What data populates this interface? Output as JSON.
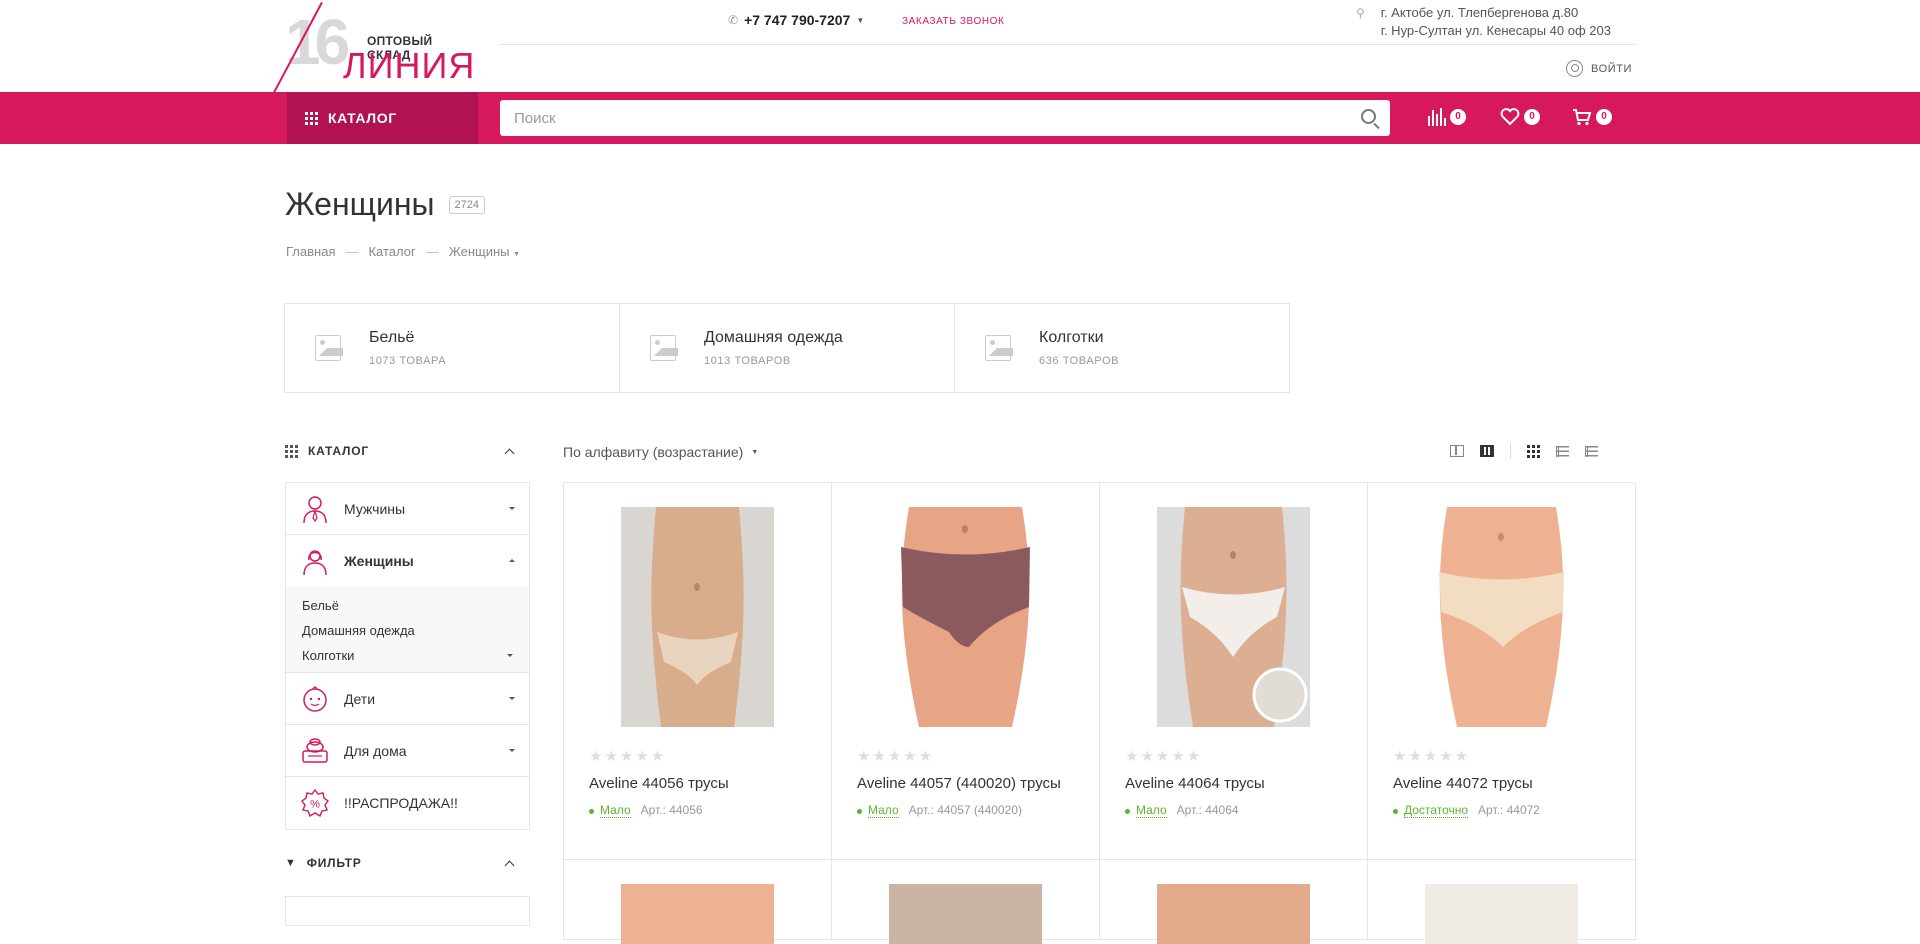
{
  "header": {
    "logo": {
      "number": "16",
      "small_text": "ОПТОВЫЙ СКЛАД",
      "big_text": "ЛИНИЯ"
    },
    "phone": "+7 747 790-7207",
    "callback_label": "ЗАКАЗАТЬ ЗВОНОК",
    "addresses": [
      "г. Актобе ул. Тлепбергенова д.80",
      "г. Нур-Султан ул. Кенесары 40 оф 203"
    ],
    "login_label": "ВОЙТИ"
  },
  "nav": {
    "catalog_label": "КАТАЛОГ",
    "search_placeholder": "Поиск",
    "compare_count": "0",
    "favorites_count": "0",
    "cart_count": "0",
    "accent_color": "#d6185f"
  },
  "page": {
    "title": "Женщины",
    "count": "2724",
    "breadcrumb": [
      "Главная",
      "Каталог",
      "Женщины"
    ]
  },
  "subcategories": [
    {
      "name": "Бельё",
      "count": "1073 ТОВАРА"
    },
    {
      "name": "Домашняя одежда",
      "count": "1013 ТОВАРОВ"
    },
    {
      "name": "Колготки",
      "count": "636 ТОВАРОВ"
    }
  ],
  "sidebar": {
    "catalog_heading": "КАТАЛОГ",
    "items": [
      {
        "label": "Мужчины",
        "icon": "man-icon"
      },
      {
        "label": "Женщины",
        "icon": "woman-icon"
      },
      {
        "label": "Дети",
        "icon": "baby-icon"
      },
      {
        "label": "Для дома",
        "icon": "towels-icon"
      },
      {
        "label": "!!РАСПРОДАЖА!!",
        "icon": "sale-percent-icon"
      }
    ],
    "women_sub": [
      "Бельё",
      "Домашняя одежда",
      "Колготки"
    ],
    "filter_heading": "ФИЛЬТР"
  },
  "toolbar": {
    "sort_label": "По алфавиту (возрастание)"
  },
  "products": [
    {
      "name": "Aveline 44056 трусы",
      "availability": "Мало",
      "article": "Арт.: 44056",
      "color": "#e9d5bf"
    },
    {
      "name": "Aveline 44057 (440020) трусы",
      "availability": "Мало",
      "article": "Арт.: 44057 (440020)",
      "color": "#8a5a5e"
    },
    {
      "name": "Aveline 44064 трусы",
      "availability": "Мало",
      "article": "Арт.: 44064",
      "color": "#f3eeea"
    },
    {
      "name": "Aveline 44072 трусы",
      "availability": "Достаточно",
      "article": "Арт.: 44072",
      "color": "#f2dcc2"
    }
  ]
}
